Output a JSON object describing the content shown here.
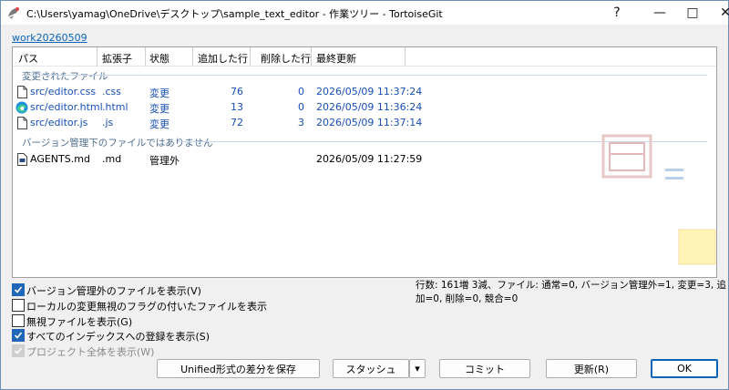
{
  "window": {
    "title": "C:\\Users\\yamag\\OneDrive\\デスクトップ\\sample_text_editor - 作業ツリー - TortoiseGit",
    "help": "?",
    "minimize": "—",
    "maximize": "□",
    "close": "✕"
  },
  "branch_link": "work20260509",
  "columns": [
    "パス",
    "拡張子",
    "状態",
    "追加した行",
    "削除した行",
    "最終更新"
  ],
  "groups": {
    "changed": "変更されたファイル",
    "unversioned": "バージョン管理下のファイルではありません"
  },
  "changed_files": [
    {
      "path": "src/editor.css",
      "ext": ".css",
      "status": "変更",
      "added": "76",
      "deleted": "0",
      "modified": "2026/05/09 11:37:24",
      "icon": "file-icon"
    },
    {
      "path": "src/editor.html",
      "ext": ".html",
      "status": "変更",
      "added": "13",
      "deleted": "0",
      "modified": "2026/05/09 11:36:24",
      "icon": "edge-icon"
    },
    {
      "path": "src/editor.js",
      "ext": ".js",
      "status": "変更",
      "added": "72",
      "deleted": "3",
      "modified": "2026/05/09 11:37:14",
      "icon": "file-icon"
    }
  ],
  "unversioned_files": [
    {
      "path": "AGENTS.md",
      "ext": ".md",
      "status": "管理外",
      "added": "",
      "deleted": "",
      "modified": "2026/05/09 11:27:59",
      "icon": "markdown-file-icon"
    }
  ],
  "options": [
    {
      "label": "バージョン管理外のファイルを表示(V)",
      "checked": true,
      "disabled": false
    },
    {
      "label": "ローカルの変更無視のフラグの付いたファイルを表示",
      "checked": false,
      "disabled": false
    },
    {
      "label": "無視ファイルを表示(G)",
      "checked": false,
      "disabled": false
    },
    {
      "label": "すべてのインデックスへの登録を表示(S)",
      "checked": true,
      "disabled": false
    },
    {
      "label": "プロジェクト全体を表示(W)",
      "checked": true,
      "disabled": true
    }
  ],
  "stats": "行数: 161増 3減、ファイル: 通常=0, バージョン管理外=1, 変更=3, 追加=0, 削除=0, 競合=0",
  "buttons": {
    "save_diff": "Unified形式の差分を保存",
    "stash": "スタッシュ",
    "stash_dropdown": "▾",
    "commit": "コミット",
    "refresh": "更新(R)",
    "ok": "OK"
  },
  "colors": {
    "link": "#0b63b8",
    "status_changed": "#174fb5",
    "checkbox_checked": "#2167b8",
    "group_header": "#4d6c8d"
  }
}
